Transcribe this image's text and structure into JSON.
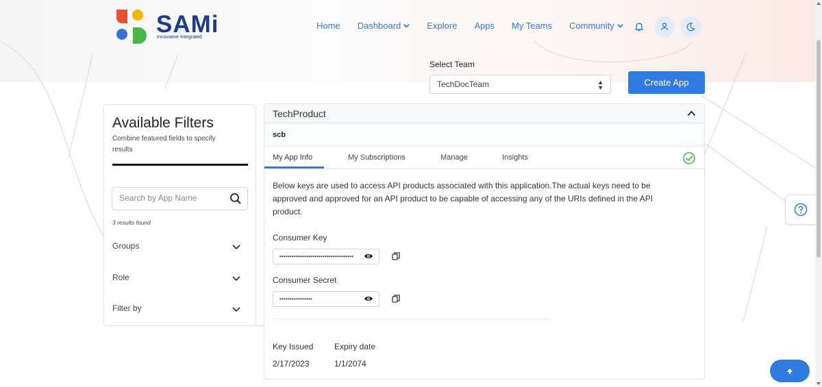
{
  "brand": {
    "name": "SAMi",
    "tagline": "Innovative-Integrated"
  },
  "nav": {
    "items": [
      {
        "label": "Home"
      },
      {
        "label": "Dashboard",
        "dropdown": true
      },
      {
        "label": "Explore"
      },
      {
        "label": "Apps"
      },
      {
        "label": "My Teams"
      },
      {
        "label": "Community",
        "dropdown": true
      }
    ],
    "icons": [
      "bell-icon",
      "user-icon",
      "moon-icon"
    ]
  },
  "team": {
    "label": "Select Team",
    "selected": "TechDocTeam",
    "create_label": "Create App"
  },
  "filters": {
    "title": "Available Filters",
    "subtitle": "Combine featured fields to specify results",
    "search_placeholder": "Search by App Name",
    "results": "3 results found",
    "groups": [
      {
        "label": "Groups"
      },
      {
        "label": "Role"
      },
      {
        "label": "Filter by"
      }
    ]
  },
  "product": {
    "name": "TechProduct",
    "app_name": "scb",
    "tabs": [
      {
        "label": "My App Info",
        "active": true
      },
      {
        "label": "My Subscriptions"
      },
      {
        "label": "Manage"
      },
      {
        "label": "Insights"
      }
    ],
    "description": "Below keys are used to access API products associated with this application.The actual keys need to be approved and approved for an API product to be capable of accessing any of the URIs defined in the API product.",
    "consumer_key_label": "Consumer Key",
    "consumer_key_masked": "••••••••••••••••••••••••••••••••••••",
    "consumer_secret_label": "Consumer Secret",
    "consumer_secret_masked": "••••••••••••••••",
    "key_issued_label": "Key Issued",
    "key_issued": "2/17/2023",
    "expiry_label": "Expiry date",
    "expiry": "1/1/2074"
  },
  "colors": {
    "accent": "#2f7be0",
    "nav": "#2f7ad6",
    "brand": "#1d3b8f",
    "success": "#4caf50"
  }
}
